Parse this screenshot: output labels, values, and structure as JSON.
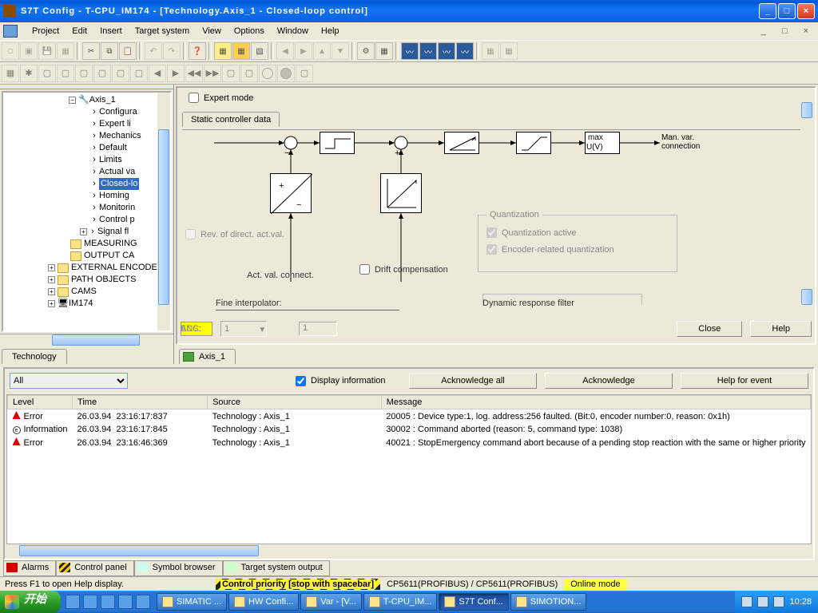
{
  "window": {
    "title": "S7T Config - T-CPU_IM174 - [Technology.Axis_1 - Closed-loop control]"
  },
  "menu": {
    "project": "Project",
    "edit": "Edit",
    "insert": "Insert",
    "target": "Target system",
    "view": "View",
    "options": "Options",
    "window": "Window",
    "help": "Help"
  },
  "tree": {
    "root": "Axis_1",
    "items": [
      "Configura",
      "Expert li",
      "Mechanics",
      "Default",
      "Limits",
      "Actual va",
      "Closed-lo",
      "Homing",
      "Monitorin",
      "Control p"
    ],
    "folders": [
      "Signal fl",
      "MEASURING",
      "OUTPUT CA"
    ],
    "ext": [
      "EXTERNAL ENCODER",
      "PATH OBJECTS",
      "CAMS",
      "IM174"
    ]
  },
  "tree_tab": "Technology",
  "editor": {
    "expert": "Expert mode",
    "tab": "Static controller data",
    "rev": "Rev. of direct. act.val.",
    "actval": "Act. val. connect.",
    "drift": "Drift compensation",
    "fine": "Fine interpolator:",
    "quant": {
      "title": "Quantization",
      "active": "Quantization active",
      "enc": "Encoder-related quantization"
    },
    "max": "max",
    "uv": "U(V)",
    "man": "Man. var. connection",
    "dyn": "Dynamic response filter",
    "ads": "ADS:",
    "adsv": "1",
    "enc": "ENC:",
    "encv": "1",
    "close": "Close",
    "help": "Help",
    "axistab": "Axis_1"
  },
  "msg": {
    "filter": "All",
    "disp": "Display information",
    "ackall": "Acknowledge all",
    "ack": "Acknowledge",
    "hfe": "Help for event",
    "cols": {
      "level": "Level",
      "time": "Time",
      "source": "Source",
      "message": "Message"
    },
    "rows": [
      {
        "lvl": "Error",
        "date": "26.03.94",
        "time": "23:16:17:837",
        "src": "Technology : Axis_1",
        "msg": "20005 : Device type:1, log. address:256 faulted. (Bit:0, encoder number:0, reason: 0x1h)"
      },
      {
        "lvl": "Information",
        "date": "26.03.94",
        "time": "23:16:17:845",
        "src": "Technology : Axis_1",
        "msg": "30002 : Command aborted (reason: 5, command type: 1038)"
      },
      {
        "lvl": "Error",
        "date": "26.03.94",
        "time": "23:16:46:369",
        "src": "Technology : Axis_1",
        "msg": "40021 : StopEmergency command abort because of a pending stop reaction with the same or higher priority"
      }
    ]
  },
  "panetabs": {
    "alarms": "Alarms",
    "cp": "Control panel",
    "sb": "Symbol browser",
    "tso": "Target system output"
  },
  "status": {
    "hint": "Press F1 to open Help display.",
    "ctrl": "Control priority [stop with spacebar]",
    "net": "CP5611(PROFIBUS) / CP5611(PROFIBUS)",
    "mode": "Online mode"
  },
  "taskbar": {
    "start": "开始",
    "tasks": [
      "SIMATIC ...",
      "HW Confi...",
      "Var - [V...",
      "T-CPU_IM...",
      "S7T Conf...",
      "SIMOTION..."
    ],
    "clock": "10:28"
  }
}
